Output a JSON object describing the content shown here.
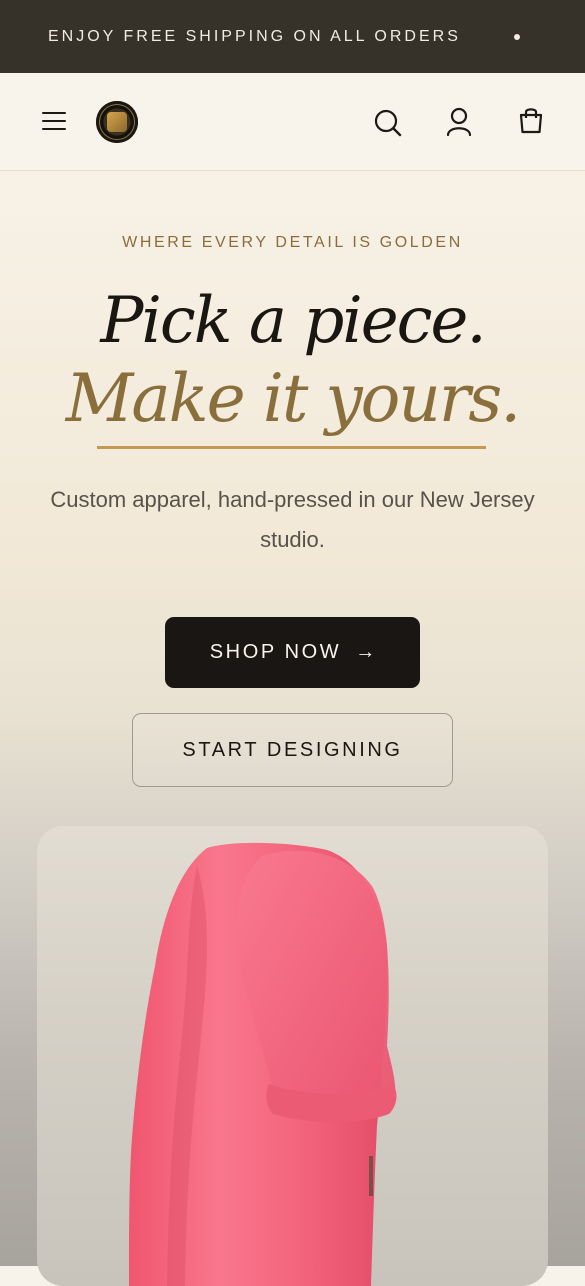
{
  "announcement": {
    "text": "ENJOY FREE SHIPPING ON ALL ORDERS"
  },
  "header": {
    "menu_icon": "hamburger-menu-icon",
    "logo": "brand-logo",
    "icons": [
      "search-icon",
      "account-icon",
      "cart-bag-icon"
    ]
  },
  "hero": {
    "eyebrow": "WHERE EVERY DETAIL IS GOLDEN",
    "title_line1": "Pick a piece.",
    "title_line2": "Make it yours.",
    "subtitle": "Custom apparel, hand-pressed in our New Jersey studio.",
    "primary_cta": "SHOP NOW",
    "primary_cta_arrow": "→",
    "secondary_cta": "START DESIGNING"
  },
  "colors": {
    "announcement_bg": "#363229",
    "gold_accent": "#8a6f3c",
    "underline": "#c49a52",
    "primary_button": "#1a1613",
    "product_color": "#f35f78"
  }
}
